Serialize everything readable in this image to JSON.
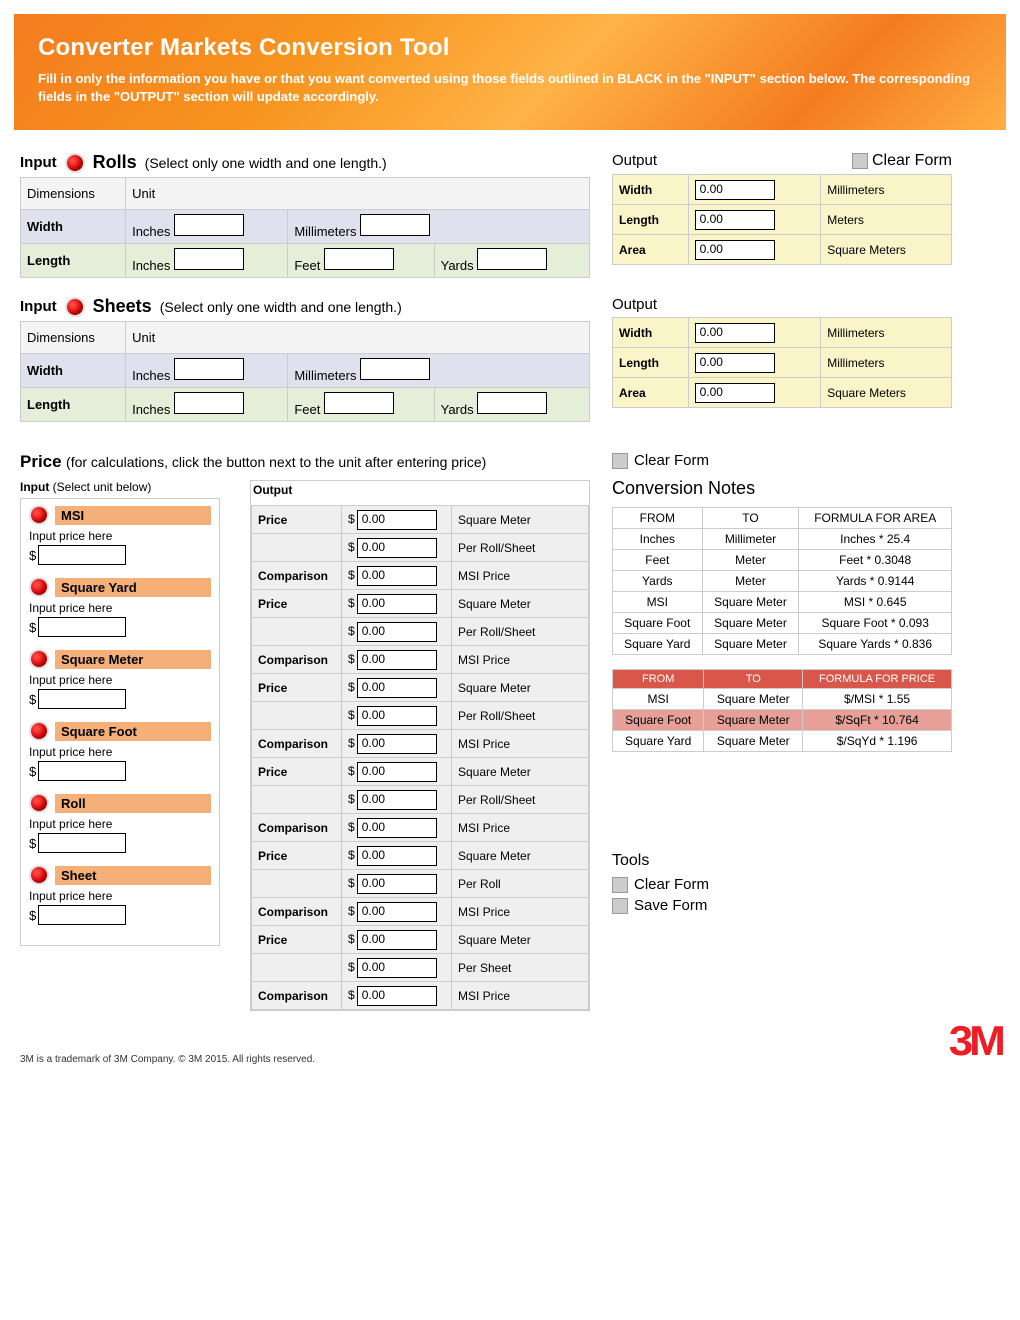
{
  "banner": {
    "title": "Converter Markets Conversion Tool",
    "subtitle": "Fill in only the information you have or that you want converted using those fields outlined in BLACK in the \"INPUT\" section below.  The corresponding fields in the \"OUTPUT\" section will update accordingly."
  },
  "labels": {
    "input": "Input",
    "output": "Output",
    "clear_form": "Clear Form",
    "save_form": "Save Form",
    "dimensions": "Dimensions",
    "unit": "Unit",
    "width": "Width",
    "length": "Length",
    "area": "Area",
    "inches": "Inches",
    "millimeters": "Millimeters",
    "feet": "Feet",
    "yards": "Yards",
    "meters": "Meters",
    "square_meters": "Square Meters",
    "price": "Price",
    "comparison": "Comparison",
    "conv_notes": "Conversion Notes",
    "tools": "Tools",
    "from": "FROM",
    "to": "TO",
    "formula_area": "FORMULA FOR AREA",
    "formula_price": "FORMULA FOR PRICE",
    "input_price_here": "Input price here",
    "input_select": "(Select unit below)"
  },
  "rolls": {
    "title": "Rolls",
    "note": "(Select only one width and one length.)",
    "output": {
      "width": "0.00",
      "length": "0.00",
      "area": "0.00"
    }
  },
  "sheets": {
    "title": "Sheets",
    "note": "(Select only one width and one length.)",
    "output": {
      "width": "0.00",
      "length": "0.00",
      "area": "0.00"
    }
  },
  "price": {
    "title": "Price",
    "note": "(for calculations, click the button next to the unit after entering price)",
    "units": [
      {
        "name": "MSI",
        "per_label": "Per Roll/Sheet"
      },
      {
        "name": "Square Yard",
        "per_label": "Per Roll/Sheet"
      },
      {
        "name": "Square Meter",
        "per_label": "Per Roll/Sheet"
      },
      {
        "name": "Square Foot",
        "per_label": "Per Roll/Sheet"
      },
      {
        "name": "Roll",
        "per_label": "Per Roll"
      },
      {
        "name": "Sheet",
        "per_label": "Per Sheet"
      }
    ],
    "out": {
      "sqm": "0.00",
      "per": "0.00",
      "msi": "0.00",
      "sqm_label": "Square Meter",
      "msi_label": "MSI Price"
    }
  },
  "area_table": [
    {
      "from": "Inches",
      "to": "Millimeter",
      "formula": "Inches * 25.4"
    },
    {
      "from": "Feet",
      "to": "Meter",
      "formula": "Feet * 0.3048"
    },
    {
      "from": "Yards",
      "to": "Meter",
      "formula": "Yards * 0.9144"
    },
    {
      "from": "MSI",
      "to": "Square Meter",
      "formula": "MSI * 0.645"
    },
    {
      "from": "Square Foot",
      "to": "Square Meter",
      "formula": "Square Foot * 0.093"
    },
    {
      "from": "Square Yard",
      "to": "Square Meter",
      "formula": "Square Yards * 0.836"
    }
  ],
  "price_table": [
    {
      "from": "MSI",
      "to": "Square Meter",
      "formula": "$/MSI * 1.55"
    },
    {
      "from": "Square Foot",
      "to": "Square Meter",
      "formula": "$/SqFt * 10.764"
    },
    {
      "from": "Square Yard",
      "to": "Square Meter",
      "formula": "$/SqYd * 1.196"
    }
  ],
  "footer": {
    "note": "3M is a trademark of 3M Company.  © 3M 2015. All rights reserved.",
    "logo": "3M"
  }
}
